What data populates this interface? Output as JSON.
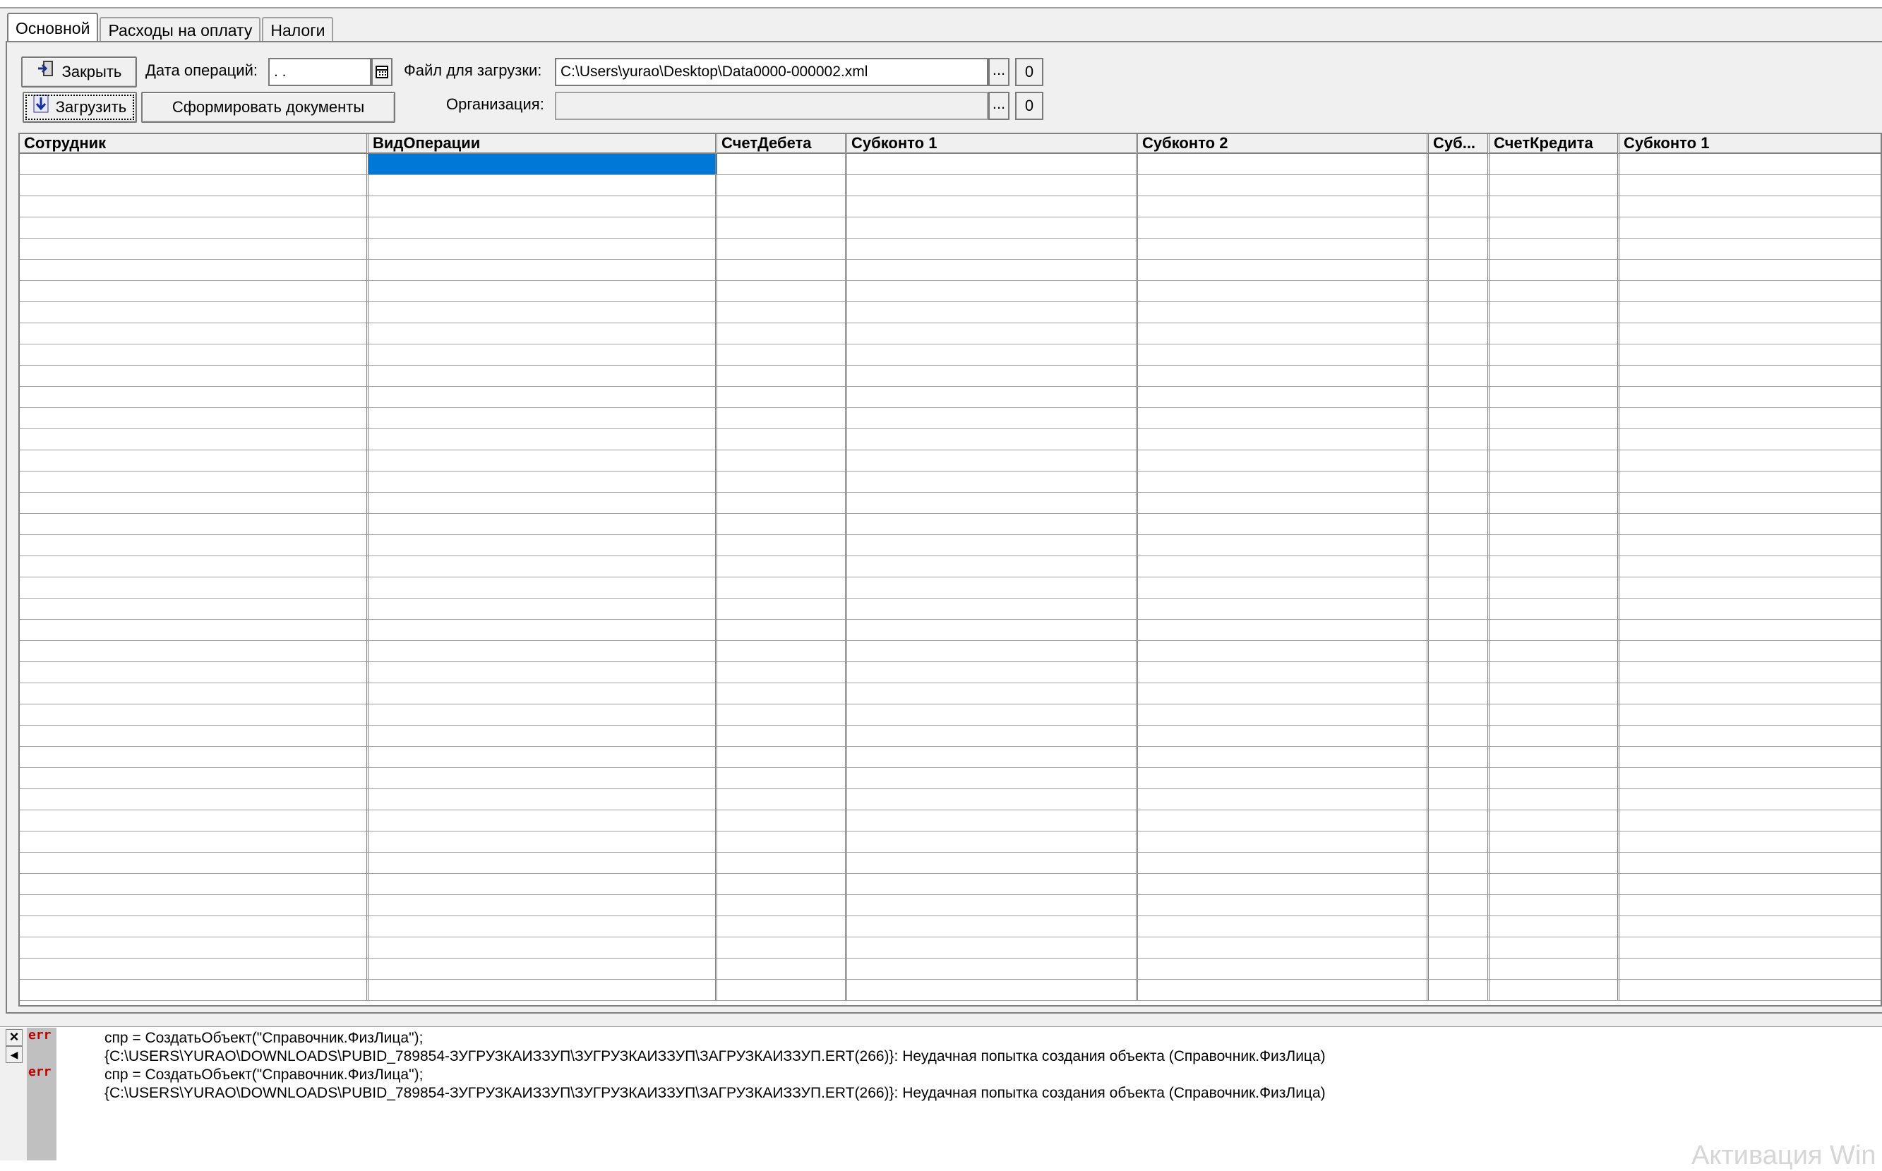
{
  "tabs": [
    {
      "label": "Основной",
      "active": true
    },
    {
      "label": "Расходы на оплату",
      "active": false
    },
    {
      "label": "Налоги",
      "active": false
    }
  ],
  "toolbar": {
    "close_label": "Закрыть",
    "load_label": "Загрузить",
    "form_docs_label": "Сформировать документы",
    "date_label": "Дата операций:",
    "date_value": " .  .",
    "file_label": "Файл для загрузки:",
    "file_value": "C:\\Users\\yurao\\Desktop\\Data0000-000002.xml",
    "org_label": "Организация:",
    "org_value": "",
    "browse_label": "...",
    "zero_label": "0"
  },
  "grid": {
    "columns": [
      "Сотрудник",
      "ВидОперации",
      "СчетДебета",
      "Субконто 1",
      "Субконто 2",
      "Суб...",
      "СчетКредита",
      "Субконто 1"
    ]
  },
  "messages": [
    {
      "icon": "err",
      "line1": "спр = СоздатьОбъект(\"Справочник.ФизЛица\");",
      "line2": "{C:\\USERS\\YURAO\\DOWNLOADS\\PUBID_789854-ЗУГРУЗКАИЗЗУП\\ЗУГРУЗКАИЗЗУП\\ЗАГРУЗКАИЗЗУП.ERT(266)}: Неудачная попытка создания объекта (Справочник.ФизЛица)"
    },
    {
      "icon": "err",
      "line1": "спр = СоздатьОбъект(\"Справочник.ФизЛица\");",
      "line2": "{C:\\USERS\\YURAO\\DOWNLOADS\\PUBID_789854-ЗУГРУЗКАИЗЗУП\\ЗУГРУЗКАИЗЗУП\\ЗАГРУЗКАИЗЗУП.ERT(266)}: Неудачная попытка создания объекта (Справочник.ФизЛица)"
    }
  ],
  "message_panel": {
    "close_glyph": "×",
    "scroll_glyph": "◀"
  },
  "watermark": "Активация Win"
}
